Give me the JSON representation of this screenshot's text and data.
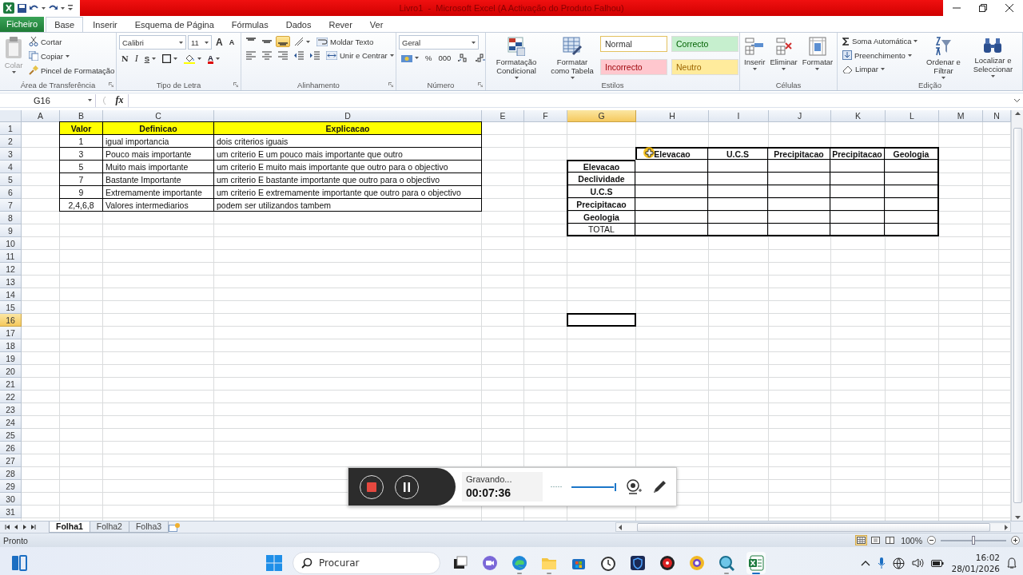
{
  "title_bar": {
    "title": "Livro1  -  Microsoft Excel (A Activação do Produto Falhou)"
  },
  "ribbon_tabs": [
    {
      "label": "Ficheiro",
      "kind": "file",
      "selected": false
    },
    {
      "label": "Base",
      "kind": "tab",
      "selected": true
    },
    {
      "label": "Inserir",
      "kind": "tab",
      "selected": false
    },
    {
      "label": "Esquema de Página",
      "kind": "tab",
      "selected": false
    },
    {
      "label": "Fórmulas",
      "kind": "tab",
      "selected": false
    },
    {
      "label": "Dados",
      "kind": "tab",
      "selected": false
    },
    {
      "label": "Rever",
      "kind": "tab",
      "selected": false
    },
    {
      "label": "Ver",
      "kind": "tab",
      "selected": false
    }
  ],
  "ribbon": {
    "clipboard": {
      "paste": {
        "label": "Colar",
        "disabled": true
      },
      "cut": "Cortar",
      "copy": "Copiar",
      "format_painter": "Pincel de Formatação",
      "label": "Área de Transferência"
    },
    "font": {
      "name": "Calibri",
      "size": "11",
      "grow": "A",
      "shrink": "A",
      "bold": "N",
      "italic": "I",
      "underline": "S",
      "font_color": "A",
      "label": "Tipo de Letra"
    },
    "alignment": {
      "vertical": [
        {
          "selected": false
        },
        {
          "selected": false
        },
        {
          "selected": true
        }
      ],
      "wrap": "Moldar Texto",
      "merge": "Unir e Centrar",
      "label": "Alinhamento"
    },
    "number": {
      "format": "Geral",
      "percent": "%",
      "thousands": "000",
      "label": "Número"
    },
    "styles": {
      "conditional": "Formatação Condicional",
      "table": "Formatar como Tabela",
      "cells": [
        {
          "label": "Normal",
          "color": "#ffffff"
        },
        {
          "label": "Correcto",
          "color": "#c6efce"
        },
        {
          "label": "Incorrecto",
          "color": "#ffc7ce"
        },
        {
          "label": "Neutro",
          "color": "#ffeb9c"
        }
      ],
      "label": "Estilos"
    },
    "cells": {
      "insert": "Inserir",
      "delete": "Eliminar",
      "format": "Formatar",
      "label": "Células"
    },
    "editing": {
      "autosum": "Soma Automática",
      "fill": "Preenchimento",
      "clear": "Limpar",
      "sort": "Ordenar e Filtrar",
      "find": "Localizar e Seleccionar",
      "label": "Edição"
    }
  },
  "formula_bar": {
    "name_box": "G16",
    "fx": "fx"
  },
  "sheet": {
    "columns": [
      {
        "label": "A",
        "selected": false
      },
      {
        "label": "B",
        "selected": false
      },
      {
        "label": "C",
        "selected": false
      },
      {
        "label": "D",
        "selected": false
      },
      {
        "label": "E",
        "selected": false
      },
      {
        "label": "F",
        "selected": false
      },
      {
        "label": "G",
        "selected": true
      },
      {
        "label": "H",
        "selected": false
      },
      {
        "label": "I",
        "selected": false
      },
      {
        "label": "J",
        "selected": false
      },
      {
        "label": "K",
        "selected": false
      },
      {
        "label": "L",
        "selected": false
      },
      {
        "label": "M",
        "selected": false
      },
      {
        "label": "N",
        "selected": false
      }
    ],
    "rows": [
      {
        "label": "1",
        "selected": false
      },
      {
        "label": "2",
        "selected": false
      },
      {
        "label": "3",
        "selected": false
      },
      {
        "label": "4",
        "selected": false
      },
      {
        "label": "5",
        "selected": false
      },
      {
        "label": "6",
        "selected": false
      },
      {
        "label": "7",
        "selected": false
      },
      {
        "label": "8",
        "selected": false
      },
      {
        "label": "9",
        "selected": false
      },
      {
        "label": "10",
        "selected": false
      },
      {
        "label": "11",
        "selected": false
      },
      {
        "label": "12",
        "selected": false
      },
      {
        "label": "13",
        "selected": false
      },
      {
        "label": "14",
        "selected": false
      },
      {
        "label": "15",
        "selected": false
      },
      {
        "label": "16",
        "selected": true
      },
      {
        "label": "17",
        "selected": false
      },
      {
        "label": "18",
        "selected": false
      },
      {
        "label": "19",
        "selected": false
      },
      {
        "label": "20",
        "selected": false
      },
      {
        "label": "21",
        "selected": false
      },
      {
        "label": "22",
        "selected": false
      },
      {
        "label": "23",
        "selected": false
      },
      {
        "label": "24",
        "selected": false
      },
      {
        "label": "25",
        "selected": false
      },
      {
        "label": "26",
        "selected": false
      },
      {
        "label": "27",
        "selected": false
      },
      {
        "label": "28",
        "selected": false
      },
      {
        "label": "29",
        "selected": false
      },
      {
        "label": "30",
        "selected": false
      },
      {
        "label": "31",
        "selected": false
      }
    ]
  },
  "criteria_table": {
    "header": [
      "Valor",
      "Definicao",
      "Explicacao"
    ],
    "rows": [
      [
        "1",
        "igual importancia",
        "dois criterios iguais"
      ],
      [
        "3",
        "Pouco mais importante",
        "um criterio E um pouco mais importante que outro"
      ],
      [
        "5",
        "Muito mais importante",
        "um criterio E muito mais importante que outro para o objectivo"
      ],
      [
        "7",
        "Bastante Importante",
        "um criterio E bastante importante que outro para o objectivo"
      ],
      [
        "9",
        "Extremamente importante",
        "um criterio E extremamente importante que outro para o objectivo"
      ],
      [
        "2,4,6,8",
        "Valores intermediarios",
        "podem ser utilizandos tambem"
      ]
    ]
  },
  "matrix": {
    "columns": [
      "Elevacao",
      "U.C.S",
      "Precipitacao",
      "Precipitacao",
      "Geologia"
    ],
    "rows": [
      "Elevacao",
      "Declividade",
      "U.C.S",
      "Precipitacao",
      "Geologia"
    ],
    "total": "TOTAL"
  },
  "sheet_tabs": [
    {
      "label": "Folha1",
      "selected": true
    },
    {
      "label": "Folha2",
      "selected": false
    },
    {
      "label": "Folha3",
      "selected": false
    }
  ],
  "status_bar": {
    "status": "Pronto",
    "zoom": "100%",
    "zoom_slider": {
      "level": 0.5
    }
  },
  "recorder": {
    "status": "Gravando...",
    "time": "00:07:36",
    "volume": {
      "level": 0.95
    }
  },
  "taskbar": {
    "search_placeholder": "Procurar",
    "time": "16:02",
    "date": "28/01/2026"
  }
}
